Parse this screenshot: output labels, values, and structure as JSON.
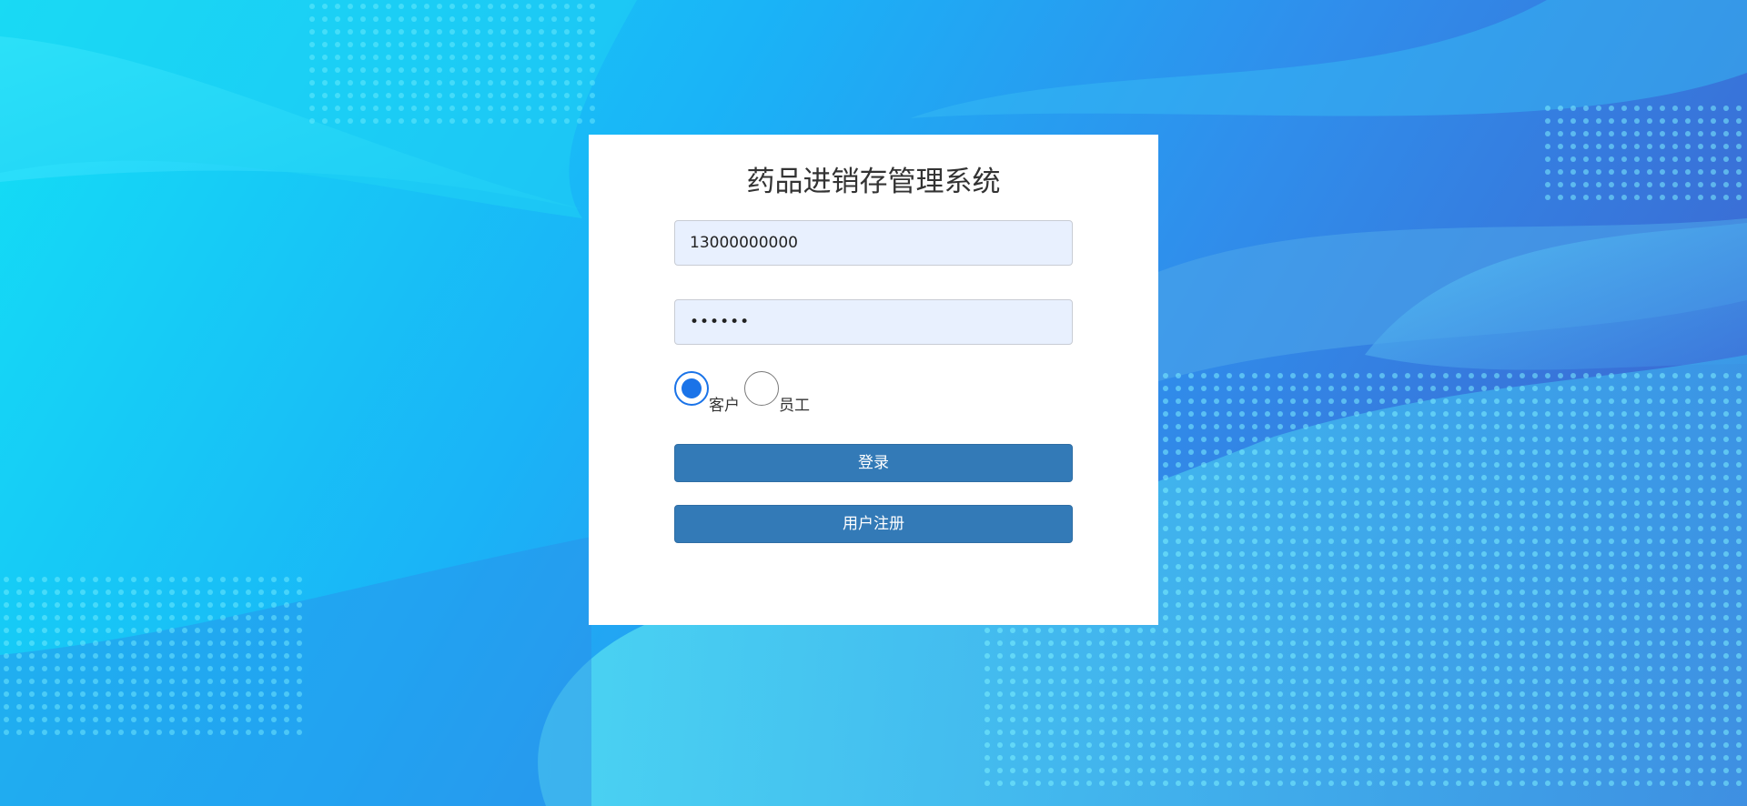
{
  "login": {
    "title": "药品进销存管理系统",
    "username_value": "13000000000",
    "password_value": "••••••",
    "roles": [
      {
        "label": "客户",
        "selected": true
      },
      {
        "label": "员工",
        "selected": false
      }
    ],
    "login_button": "登录",
    "register_button": "用户注册"
  },
  "colors": {
    "button": "#337ab7",
    "input_bg": "#e8f0fe",
    "radio_accent": "#1a73e8"
  }
}
